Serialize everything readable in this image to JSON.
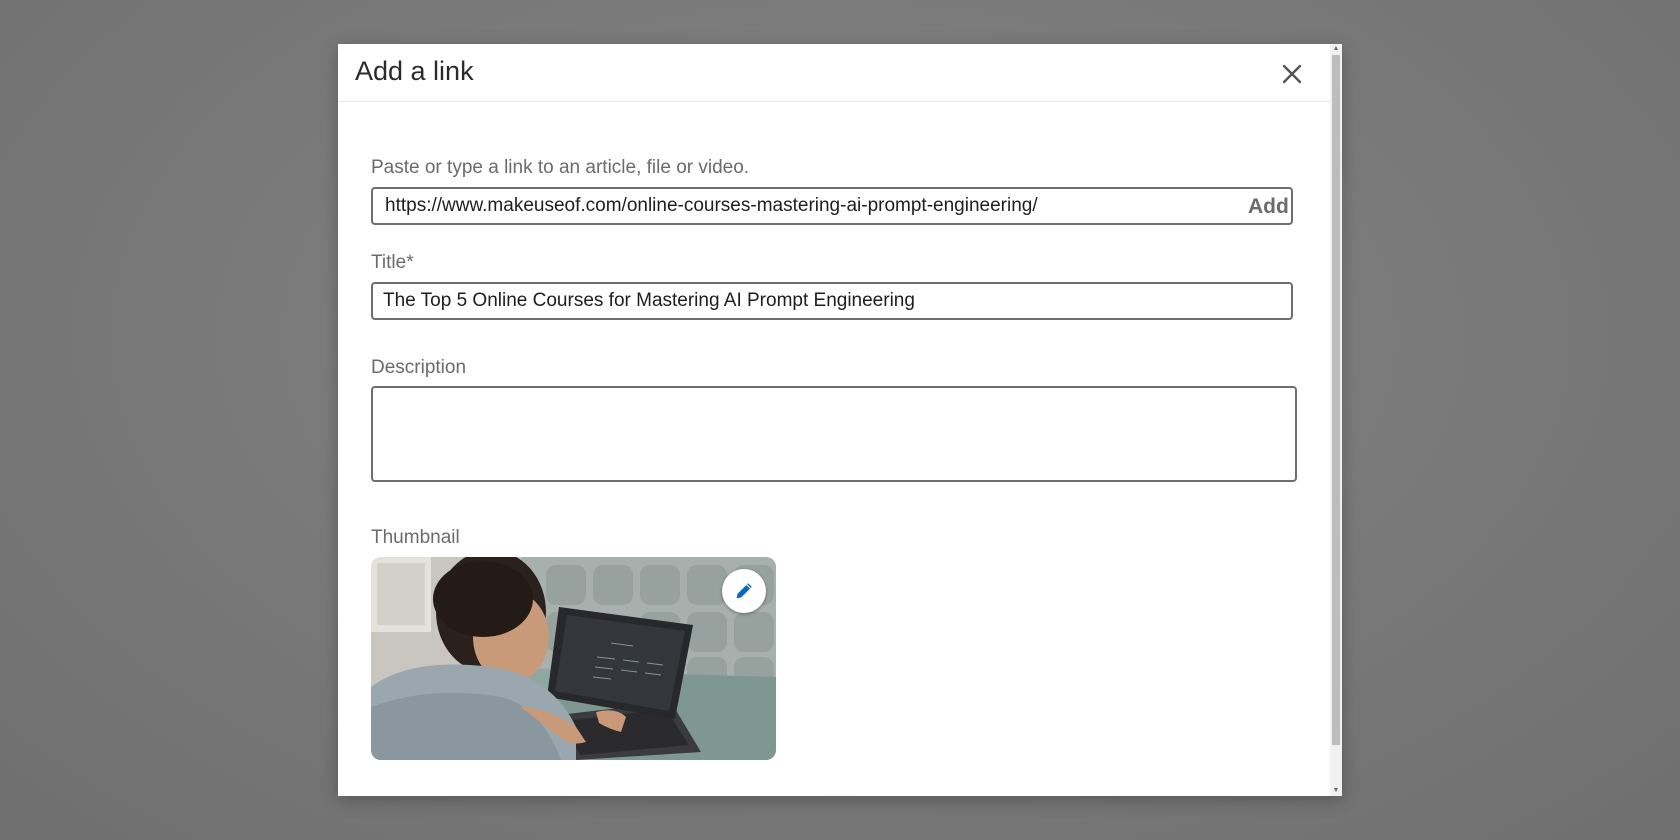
{
  "modal": {
    "title": "Add a link",
    "close_icon": "close-icon"
  },
  "link_field": {
    "label": "Paste or type a link to an article, file or video.",
    "value": "https://www.makeuseof.com/online-courses-mastering-ai-prompt-engineering/",
    "add_label": "Add"
  },
  "title_field": {
    "label": "Title*",
    "value": "The Top 5 Online Courses for Mastering AI Prompt Engineering"
  },
  "description_field": {
    "label": "Description",
    "value": ""
  },
  "thumbnail": {
    "label": "Thumbnail",
    "image_subject": "person typing on laptop",
    "edit_icon": "pencil-icon"
  },
  "colors": {
    "backdrop": "#7a7a7a",
    "modal_bg": "#ffffff",
    "input_border": "#6e6e6e",
    "label_text": "#6b6b6b",
    "edit_icon": "#0a66c2"
  }
}
